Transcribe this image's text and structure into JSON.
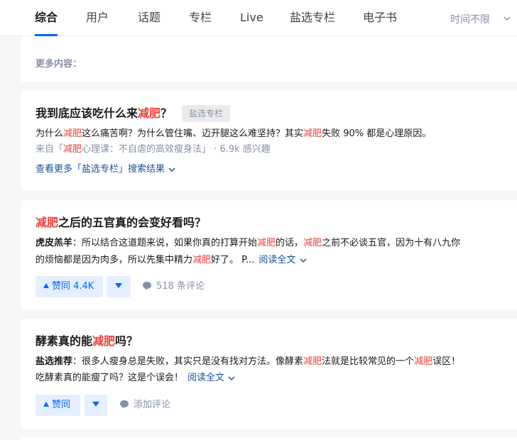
{
  "tabs": [
    {
      "label": "综合",
      "active": true
    },
    {
      "label": "用户"
    },
    {
      "label": "话题"
    },
    {
      "label": "专栏"
    },
    {
      "label": "Live"
    },
    {
      "label": "盐选专栏"
    },
    {
      "label": "电子书"
    }
  ],
  "time_filter": "时间不限",
  "more_content_label": "更多内容：",
  "colors": {
    "accent": "#0066ff",
    "highlight": "#f1403c",
    "link": "#175199",
    "muted": "#8590a6"
  },
  "results": [
    {
      "title_pre": "我到底应该吃什么来",
      "title_hl": "减肥",
      "title_post": "？",
      "badge": "盐选专栏",
      "desc": [
        "为什么",
        "减肥",
        "这么痛苦啊？为什么管住嘴、迈开腿这么难坚持？其实",
        "减肥",
        "失败 90% 都是心理原因。"
      ],
      "source": [
        "来自「",
        "减肥",
        "心理课：不自虐的高效瘦身法」 · 6.9k 感兴趣"
      ],
      "more_link": "查看更多「盐选专栏」搜索结果"
    },
    {
      "title_hl": "减肥",
      "title_post": "之后的五官真的会变好看吗？",
      "author": "虎皮羔羊",
      "line1": [
        "：所以结合这道题来说，如果你真的打算开始",
        "减肥",
        "的话，",
        "减肥",
        "之前不必谈五官，因为十有八九你"
      ],
      "line2": [
        "的烦恼都是因为肉多，所以先集中精力",
        "减肥",
        "好了。 P..."
      ],
      "read_more": "阅读全文",
      "vote_label": "赞同 4.4K",
      "comment_label": "518 条评论"
    },
    {
      "title_pre": "酵素真的能",
      "title_hl": "减肥",
      "title_post": "吗？",
      "author": "盐选推荐",
      "line1": [
        "：很多人瘦身总是失败，其实只是没有找对方法。像酵素",
        "减肥",
        "法就是比较常见的一个",
        "减肥",
        "误区！"
      ],
      "line2": [
        "吃酵素真的能瘦了吗？这是个误会！"
      ],
      "read_more": "阅读全文",
      "vote_label": "赞同",
      "comment_label": "添加评论"
    }
  ]
}
